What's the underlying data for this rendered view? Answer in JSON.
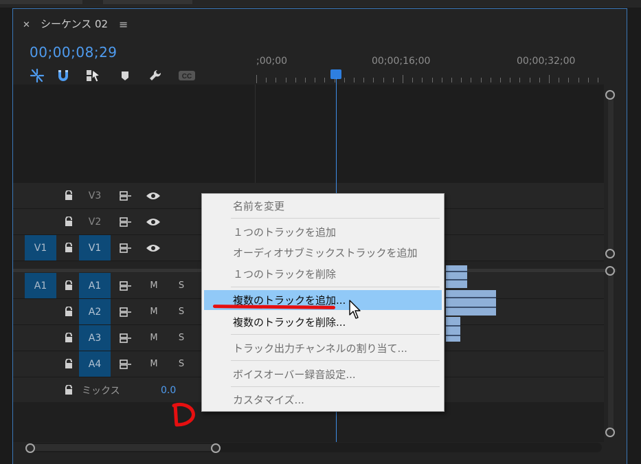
{
  "colors": {
    "panel_border": "#3b78b8",
    "timecode": "#4f9cf0",
    "track_target": "#0d4a78",
    "playhead": "#2e7fe0",
    "menu_highlight": "#91c9f7",
    "annotation": "#e60f10",
    "clip": "#8fb0d8"
  },
  "tab": {
    "close_icon": "close-icon",
    "title": "シーケンス 02",
    "menu_icon": "hamburger-icon"
  },
  "timecode": "00;00;08;29",
  "toolbar": {
    "icons": [
      "nest-icon",
      "snap-magnet-icon",
      "linked-selection-icon",
      "marker-icon",
      "wrench-icon",
      "captions-icon"
    ]
  },
  "ruler": {
    "labels": [
      ";00;00",
      "00;00;16;00",
      "00;00;32;00"
    ]
  },
  "video_tracks": [
    {
      "source": "",
      "name": "V3",
      "active": false
    },
    {
      "source": "",
      "name": "V2",
      "active": false
    },
    {
      "source": "V1",
      "name": "V1",
      "active": true
    }
  ],
  "audio_tracks": [
    {
      "source": "A1",
      "name": "A1",
      "m": "M",
      "s": "S"
    },
    {
      "source": "",
      "name": "A2",
      "m": "M",
      "s": "S"
    },
    {
      "source": "",
      "name": "A3",
      "m": "M",
      "s": "S"
    },
    {
      "source": "",
      "name": "A4",
      "m": "M",
      "s": "S"
    }
  ],
  "mix": {
    "label": "ミックス",
    "value": "0.0"
  },
  "context_menu": {
    "items": [
      {
        "label": "名前を変更",
        "enabled": false
      },
      {
        "label": "１つのトラックを追加",
        "enabled": false
      },
      {
        "label": "オーディオサブミックストラックを追加",
        "enabled": false
      },
      {
        "label": "１つのトラックを削除",
        "enabled": false
      },
      {
        "label": "複数のトラックを追加...",
        "enabled": true,
        "highlighted": true
      },
      {
        "label": "複数のトラックを削除...",
        "enabled": true
      },
      {
        "label": "トラック出力チャンネルの割り当て...",
        "enabled": false
      },
      {
        "label": "ボイスオーバー録音設定...",
        "enabled": false
      },
      {
        "label": "カスタマイズ...",
        "enabled": false
      }
    ]
  }
}
